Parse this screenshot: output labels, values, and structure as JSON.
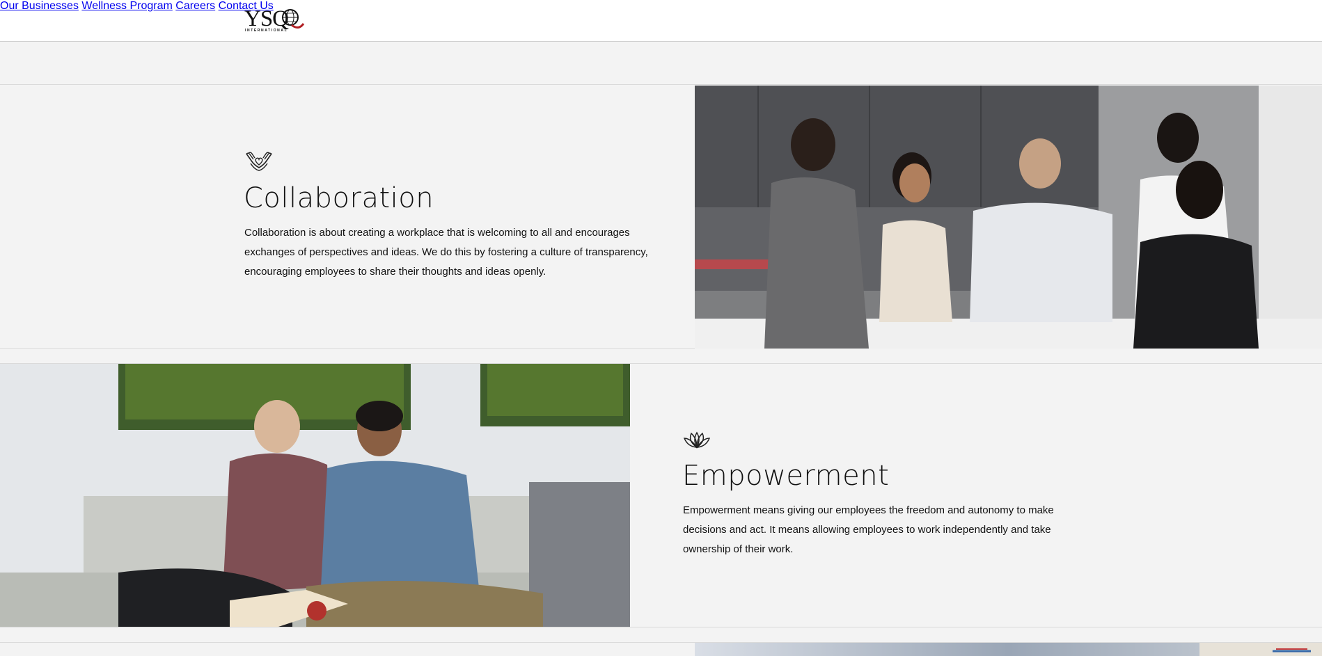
{
  "header": {
    "logo_text": "YSQ",
    "logo_subtext": "INTERNATIONAL",
    "nav": [
      {
        "label": "Our Businesses"
      },
      {
        "label": "Wellness Program"
      },
      {
        "label": "Careers"
      },
      {
        "label": "Contact Us"
      }
    ]
  },
  "values": [
    {
      "icon": "hands-heart-icon",
      "title": "Collaboration",
      "text": "Collaboration is about creating a workplace that is welcoming to all and encourages exchanges of perspectives and ideas. We do this by fostering a culture of transparency, encouraging employees to share their thoughts and ideas openly.",
      "image": "team-meeting-photo"
    },
    {
      "icon": "lotus-icon",
      "title": "Empowerment",
      "text": "Empowerment means giving our employees the freedom and autonomy to make decisions and act. It means allowing employees to work independently and take ownership of their work.",
      "image": "colleagues-reviewing-photo"
    }
  ],
  "colors": {
    "background": "#f3f3f3",
    "header_bg": "#ffffff",
    "logo_accent": "#b01e23",
    "text": "#111111"
  }
}
